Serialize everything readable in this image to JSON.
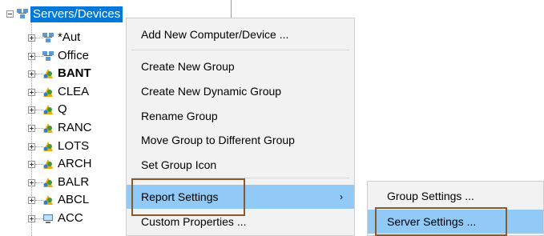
{
  "tree": {
    "root": {
      "label": "Servers/Devices"
    },
    "items": [
      {
        "label": "*Aut",
        "bold": false,
        "icon": "network-group-icon"
      },
      {
        "label": "Office",
        "bold": false,
        "icon": "network-group-icon"
      },
      {
        "label": "BANT",
        "bold": true,
        "icon": "dynamic-group-icon"
      },
      {
        "label": "CLEA",
        "bold": false,
        "icon": "dynamic-group-icon"
      },
      {
        "label": "Q",
        "bold": false,
        "icon": "dynamic-group-icon"
      },
      {
        "label": "RANC",
        "bold": false,
        "icon": "dynamic-group-icon"
      },
      {
        "label": "LOTS",
        "bold": false,
        "icon": "dynamic-group-icon"
      },
      {
        "label": "ARCH",
        "bold": false,
        "icon": "dynamic-group-icon"
      },
      {
        "label": "BALR",
        "bold": false,
        "icon": "dynamic-group-icon"
      },
      {
        "label": "ABCL",
        "bold": false,
        "icon": "dynamic-group-icon"
      },
      {
        "label": "ACC",
        "bold": false,
        "icon": "computer-icon"
      }
    ]
  },
  "context_menu": {
    "items": [
      {
        "label": "Add New Computer/Device ..."
      },
      {
        "label": "Create New Group"
      },
      {
        "label": "Create New Dynamic Group"
      },
      {
        "label": "Rename Group"
      },
      {
        "label": "Move Group to Different Group"
      },
      {
        "label": "Set Group Icon"
      },
      {
        "label": "Report Settings",
        "submenu_arrow": "›",
        "active": true
      },
      {
        "label": "Custom Properties ..."
      }
    ]
  },
  "submenu": {
    "items": [
      {
        "label": "Group Settings ..."
      },
      {
        "label": "Server Settings ...",
        "active": true
      }
    ]
  },
  "colors": {
    "selection": "#0078d7",
    "menu_highlight": "#91c9f7",
    "callout_border": "#8b5a2b"
  }
}
